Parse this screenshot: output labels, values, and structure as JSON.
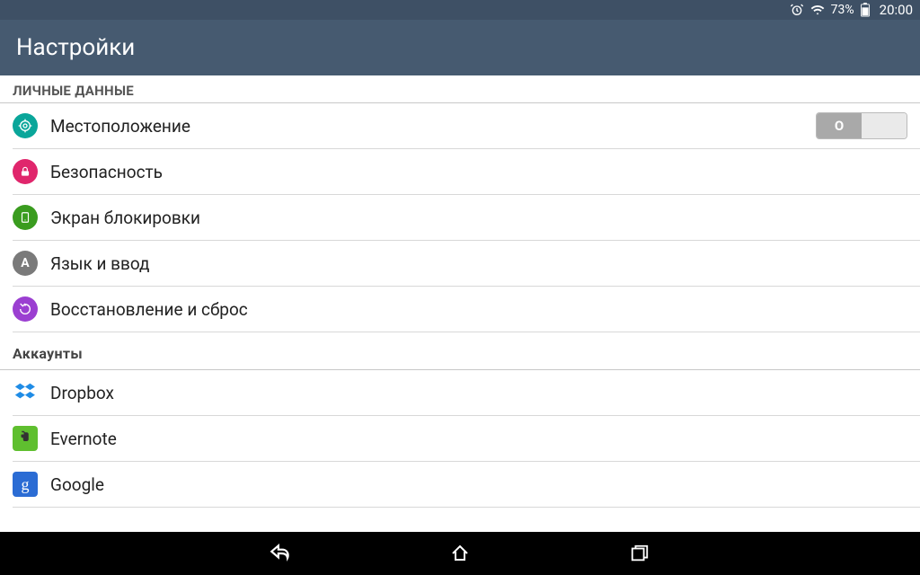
{
  "status": {
    "battery_pct": "73%",
    "time": "20:00"
  },
  "header": {
    "title": "Настройки"
  },
  "sections": {
    "personal": {
      "header": "ЛИЧНЫЕ ДАННЫЕ",
      "items": {
        "location": {
          "label": "Местоположение",
          "toggle": "O"
        },
        "security": {
          "label": "Безопасность"
        },
        "lockscreen": {
          "label": "Экран блокировки"
        },
        "language": {
          "label": "Язык и ввод"
        },
        "backup": {
          "label": "Восстановление и сброс"
        }
      }
    },
    "accounts": {
      "header": "Аккаунты",
      "items": {
        "dropbox": {
          "label": "Dropbox"
        },
        "evernote": {
          "label": "Evernote"
        },
        "google": {
          "label": "Google"
        }
      }
    }
  }
}
